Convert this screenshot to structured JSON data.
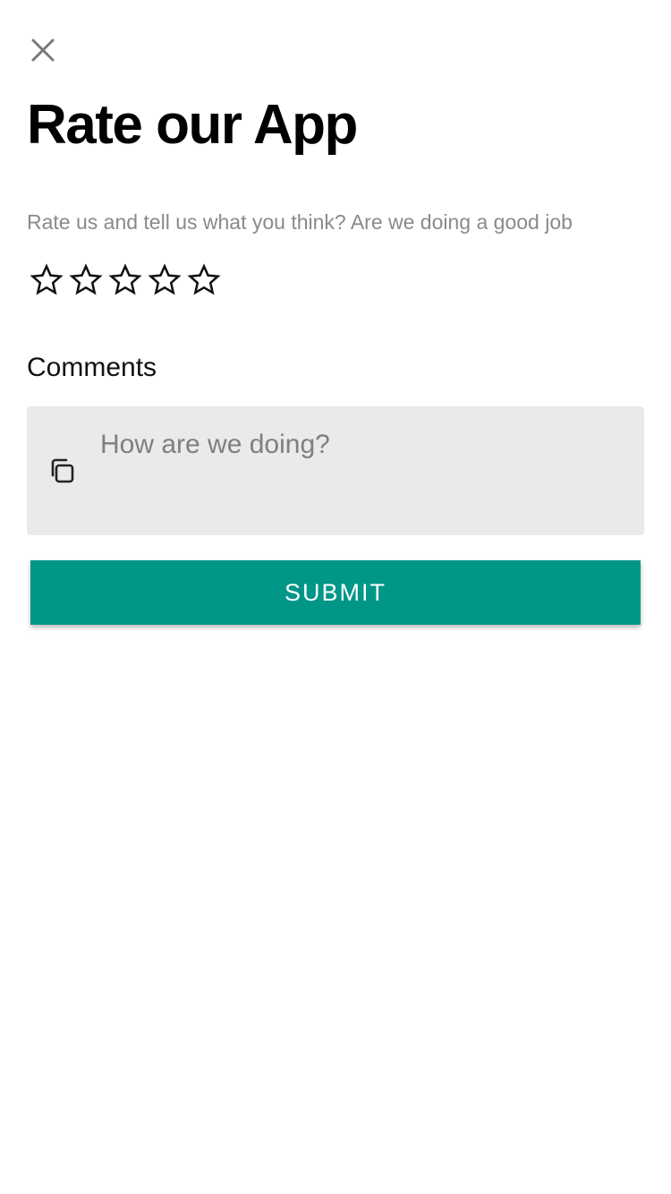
{
  "header": {
    "close_icon": "close-icon",
    "title": "Rate our App"
  },
  "rating": {
    "prompt": "Rate us and tell us what you think? Are we doing a good job",
    "max_stars": 5,
    "value": 0,
    "star_icon": "star-outline-icon"
  },
  "comments": {
    "label": "Comments",
    "placeholder": "How are we doing?",
    "value": "",
    "icon": "copy-icon",
    "background": "#e9eaec"
  },
  "submit": {
    "label": "SUBMIT",
    "color": "#009688"
  }
}
